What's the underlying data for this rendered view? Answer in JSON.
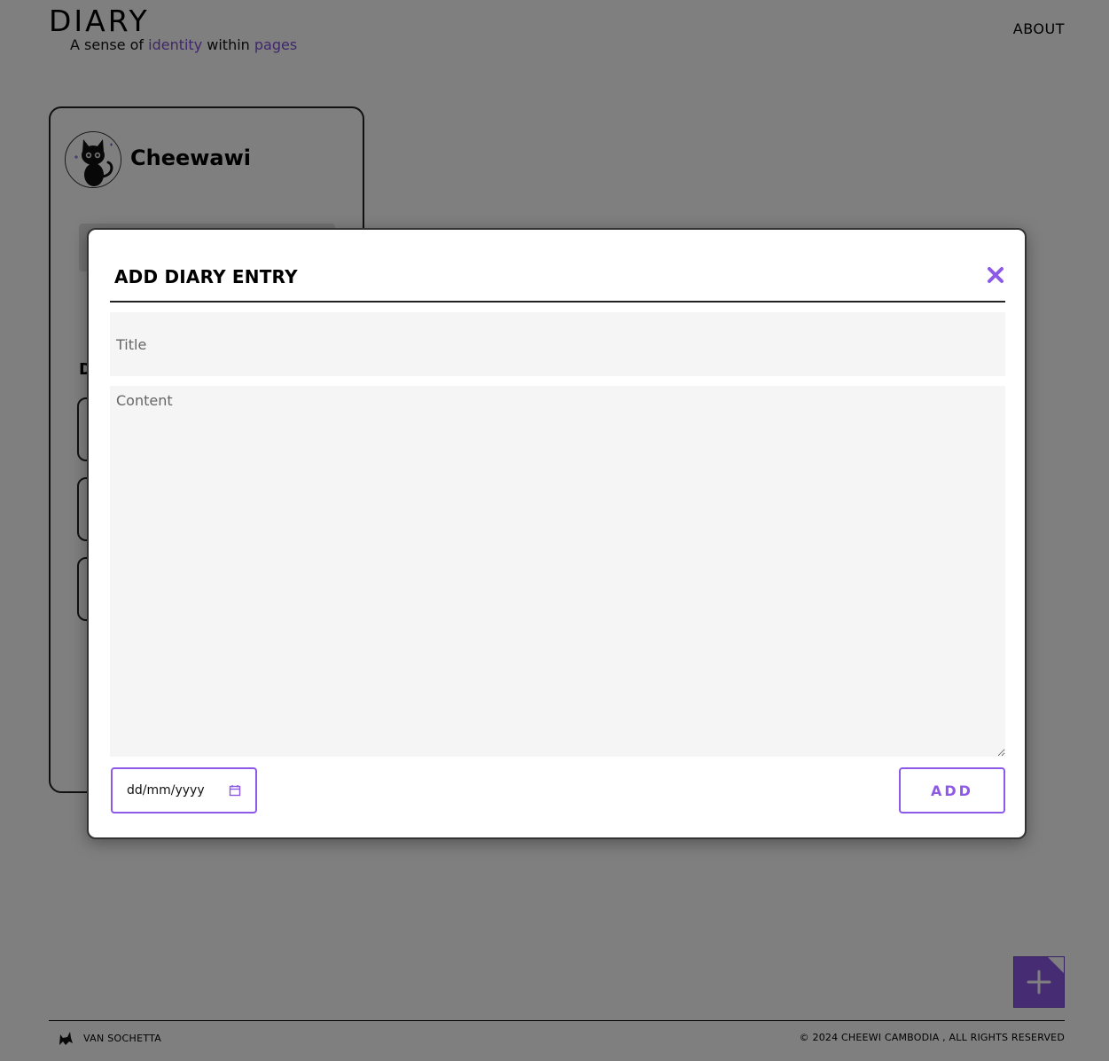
{
  "header": {
    "logo": "DIARY",
    "tagline": {
      "part1": "A sense of ",
      "accent1": "identity",
      "part2": " within ",
      "accent2": "pages"
    },
    "nav": {
      "about": "ABOUT"
    }
  },
  "profile": {
    "name": "Cheewawi",
    "avatar_icon": "black-cat-icon",
    "section_letter": "D"
  },
  "modal": {
    "title": "ADD DIARY ENTRY",
    "close_icon": "close-icon",
    "title_placeholder": "Title",
    "content_placeholder": "Content",
    "date_placeholder": "dd/mm/yyyy",
    "calendar_icon": "calendar-icon",
    "add_label": "ADD"
  },
  "fab": {
    "icon": "plus-icon"
  },
  "footer": {
    "author": "VAN SOCHETTA",
    "author_icon": "cat-logo-icon",
    "copyright": "© 2024 CHEEWI CAMBODIA , ALL RIGHTS RESERVED"
  },
  "colors": {
    "accent": "#8c5ae6",
    "overlay": "rgba(0,0,0,0.5)",
    "field_bg": "#f5f5f5"
  }
}
